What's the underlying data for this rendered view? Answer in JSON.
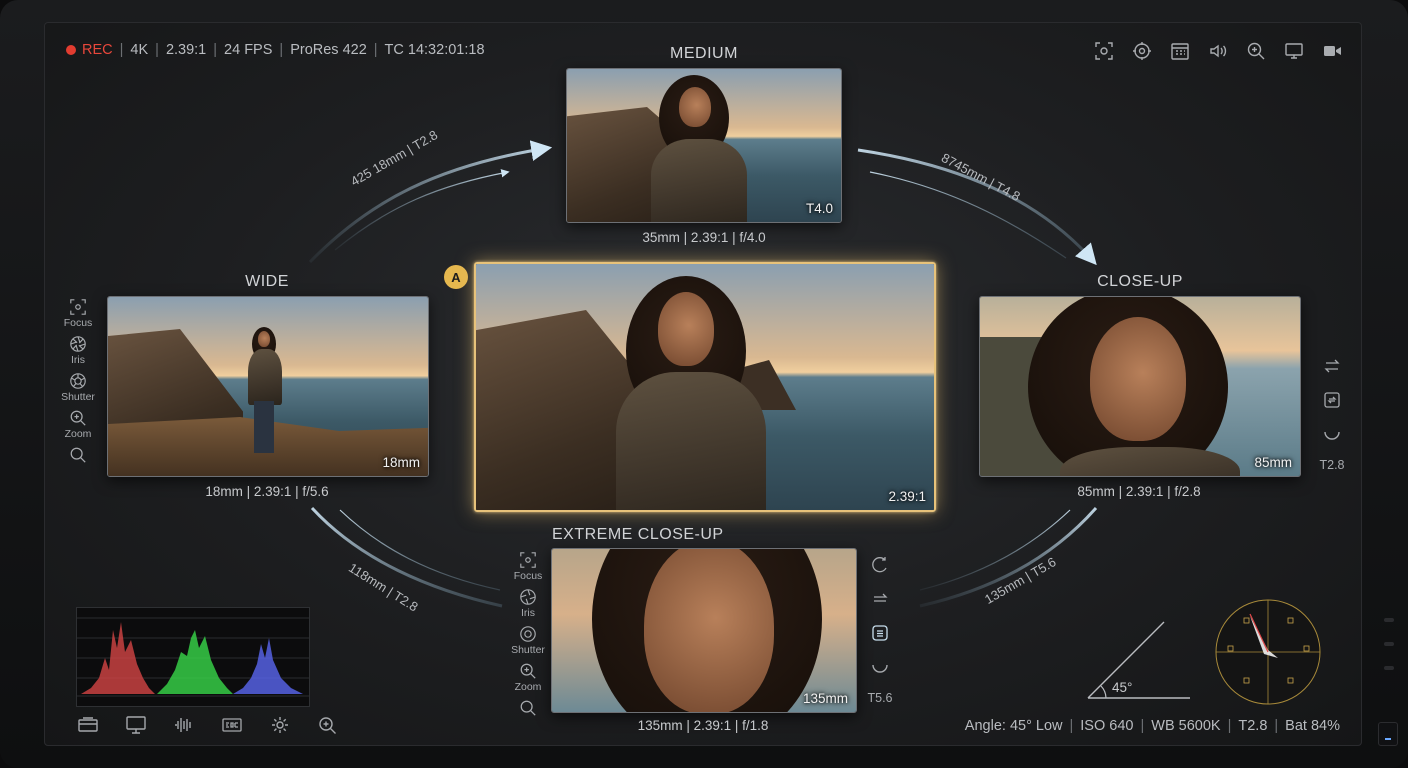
{
  "status": {
    "rec_label": "REC",
    "resolution": "4K",
    "aspect": "2.39:1",
    "fps": "24 FPS",
    "codec": "ProRes 422",
    "timecode": "TC 14:32:01:18",
    "rec_color": "#e23c30"
  },
  "top_icons": [
    "focus-target-icon",
    "crosshair-icon",
    "calendar-grid-icon",
    "speaker-icon",
    "zoom-in-icon",
    "monitor-icon",
    "video-camera-icon"
  ],
  "shots": {
    "medium": {
      "label": "MEDIUM",
      "badge": "T4.0",
      "caption": "35mm | 2.39:1 | f/4.0"
    },
    "wide": {
      "label": "WIDE",
      "badge": "18mm",
      "caption": "18mm | 2.39:1 | f/5.6"
    },
    "center": {
      "badge": "2.39:1",
      "marker": "A"
    },
    "closeup": {
      "label": "CLOSE-UP",
      "badge": "85mm",
      "caption": "85mm | 2.39:1 | f/2.8",
      "side_value": "T2.8"
    },
    "ecu": {
      "label": "EXTREME CLOSE-UP",
      "badge": "135mm",
      "caption": "135mm | 2.39:1 | f/1.8",
      "side_value": "T5.6"
    }
  },
  "transitions": {
    "wide_medium": "425 18mm | T2.8",
    "medium_close": "8745mm | T4.8",
    "wide_ecu": "118mm | T2.8",
    "ecu_close": "135mm | T5.6"
  },
  "controls": {
    "focus": "Focus",
    "iris": "Iris",
    "shutter": "Shutter",
    "zoom": "Zoom"
  },
  "angle_label": "45°",
  "footer": {
    "angle": "Angle: 45° Low",
    "iso": "ISO 640",
    "wb": "WB 5600K",
    "t_stop": "T2.8",
    "battery": "Bat 84%"
  },
  "accent": "#e6b84f",
  "bottom_icons": [
    "layers-icon",
    "monitor-icon",
    "waveform-icon",
    "record-box-icon",
    "gear-icon",
    "zoom-in-icon"
  ]
}
